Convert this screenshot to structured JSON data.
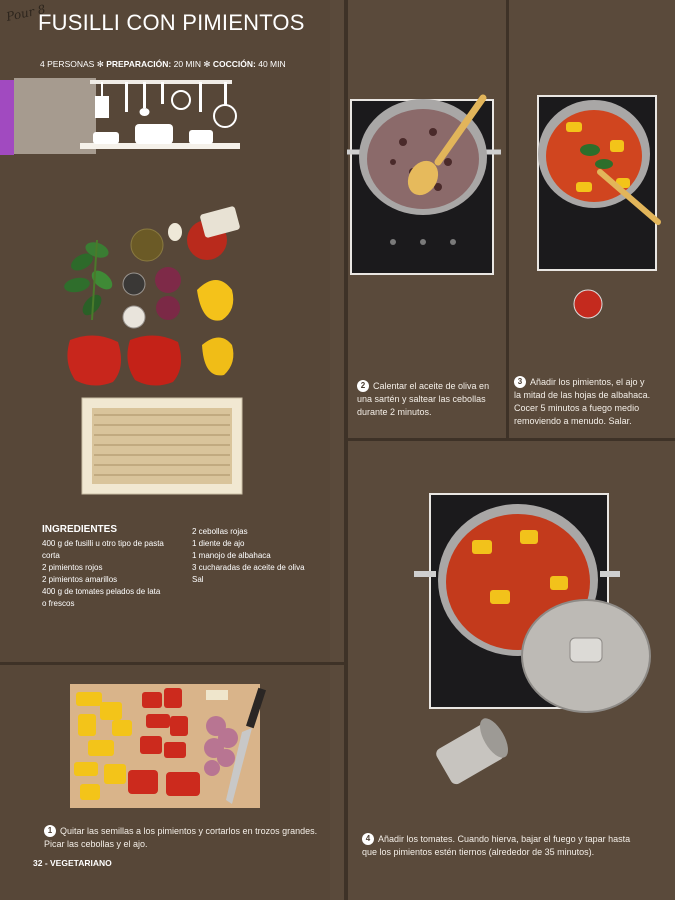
{
  "recipe": {
    "title": "FUSILLI CON PIMIENTOS",
    "handwriting": "Pour 8",
    "servings": "4 PERSONAS",
    "prep_label": "PREPARACIÓN:",
    "prep_time": "20 MIN",
    "cook_label": "COCCIÓN:",
    "cook_time": "40 MIN",
    "separator": "✻"
  },
  "ingredients": {
    "heading": "INGREDIENTES",
    "col1": [
      "400 g de fusilli u otro tipo de pasta",
      "corta",
      "2 pimientos rojos",
      "2 pimientos amarillos",
      "400 g de tomates pelados de lata",
      "o frescos"
    ],
    "col2": [
      "2 cebollas rojas",
      "1 diente de ajo",
      "1 manojo de albahaca",
      "3 cucharadas de aceite de oliva",
      "Sal"
    ]
  },
  "steps": [
    {
      "number": "1",
      "line1": "Quitar las semillas a los pimientos y cortarlos en trozos grandes.",
      "line2": "Picar las cebollas y el ajo."
    },
    {
      "number": "2",
      "line1": "Calentar el aceite de oliva en",
      "line2": "una sartén y saltear las cebollas",
      "line3": "durante 2 minutos."
    },
    {
      "number": "3",
      "line1": "Añadir los pimientos, el ajo y",
      "line2": "la mitad de las hojas de albahaca.",
      "line3": "Cocer 5 minutos a fuego medio",
      "line4": "removiendo a menudo. Salar."
    },
    {
      "number": "4",
      "line1": "Añadir los tomates. Cuando hierva, bajar el fuego y tapar hasta",
      "line2": "que los pimientos estén tiernos (alrededor de 35 minutos)."
    }
  ],
  "footer": "32 - VEGETARIANO",
  "colors": {
    "background": "#574738",
    "accent_purple": "#a14ac0",
    "pepper_red": "#c8261c",
    "pepper_yellow": "#f2c21b"
  }
}
